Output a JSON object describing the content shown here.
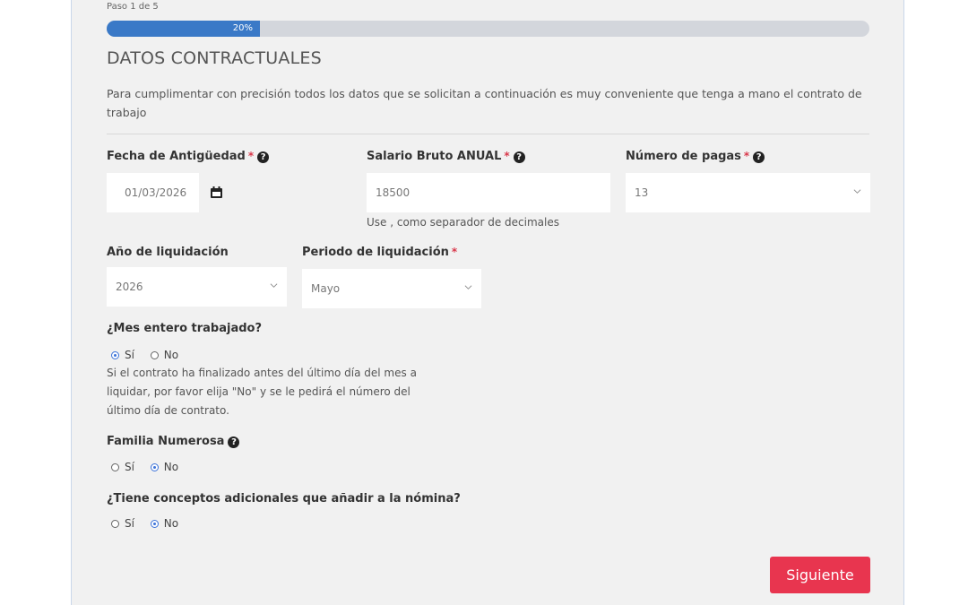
{
  "progress": {
    "step_text": "Paso 1 de 5",
    "percent_label": "20%",
    "percent": 20
  },
  "section": {
    "title": "DATOS CONTRACTUALES",
    "intro": "Para cumplimentar con precisión todos los datos que se solicitan a continuación es muy conveniente que tenga a mano el contrato de trabajo"
  },
  "fields": {
    "antiguedad": {
      "label": "Fecha de Antigüedad",
      "required": "*",
      "value": "01/03/2026"
    },
    "salario": {
      "label": "Salario Bruto ANUAL",
      "required": "*",
      "value": "18500",
      "hint": "Use , como separador de decimales"
    },
    "pagas": {
      "label": "Número de pagas",
      "required": "*",
      "value": "13"
    },
    "anio": {
      "label": "Año de liquidación",
      "value": "2026"
    },
    "periodo": {
      "label": "Periodo de liquidación",
      "required": "*",
      "value": "Mayo"
    }
  },
  "questions": {
    "mes_entero": {
      "label": "¿Mes entero trabajado?",
      "options": [
        "Sí",
        "No"
      ],
      "selected": "Sí",
      "note": "Si el contrato ha finalizado antes del último día del mes a liquidar, por favor elija \"No\" y se le pedirá el número del último día de contrato."
    },
    "familia": {
      "label": "Familia Numerosa",
      "options": [
        "Sí",
        "No"
      ],
      "selected": "No"
    },
    "conceptos": {
      "label": "¿Tiene conceptos adicionales que añadir a la nómina?",
      "options": [
        "Sí",
        "No"
      ],
      "selected": "No"
    }
  },
  "help_icon": "?",
  "buttons": {
    "next": "Siguiente"
  },
  "colors": {
    "accent": "#3a79c7",
    "primary_button": "#e8354f",
    "required": "#d9374a",
    "radio_selected": "#3b72d9"
  }
}
